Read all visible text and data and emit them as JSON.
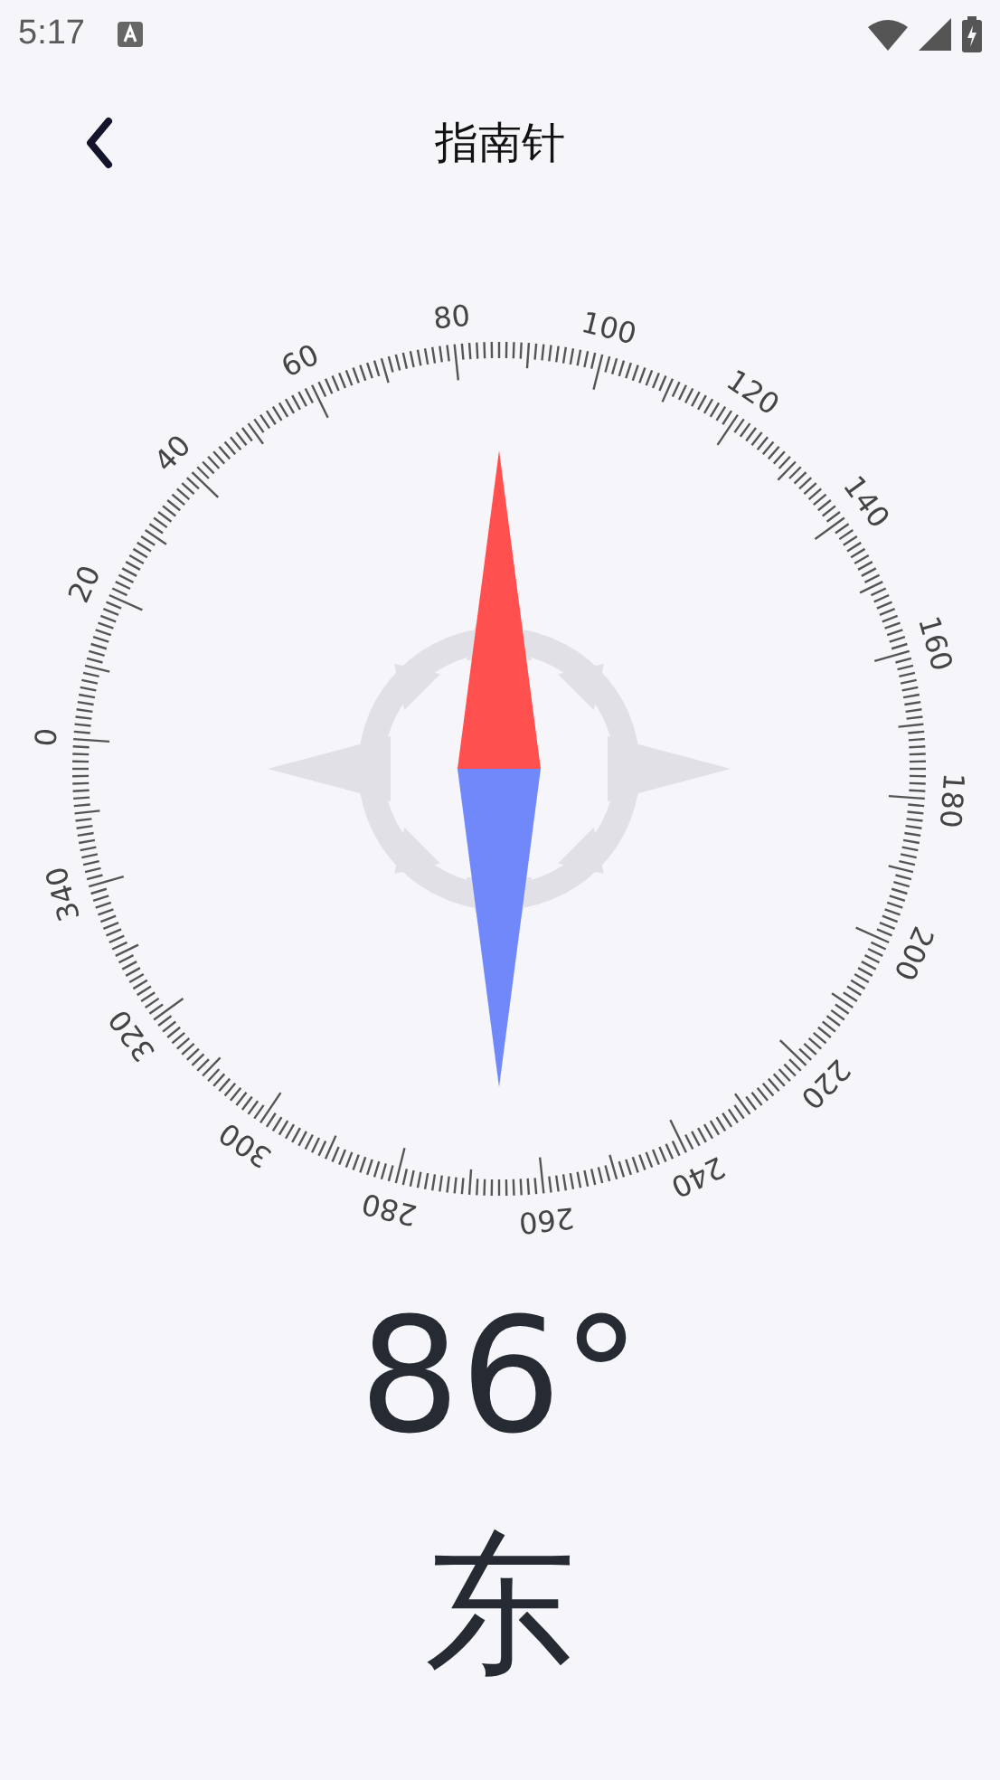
{
  "status_bar": {
    "time": "5:17"
  },
  "header": {
    "title": "指南针"
  },
  "dial": {
    "labels": [
      "0",
      "20",
      "40",
      "60",
      "80",
      "100",
      "120",
      "140",
      "160",
      "180",
      "200",
      "220",
      "240",
      "260",
      "280",
      "300",
      "320",
      "340"
    ]
  },
  "heading": "86°",
  "direction": "东"
}
